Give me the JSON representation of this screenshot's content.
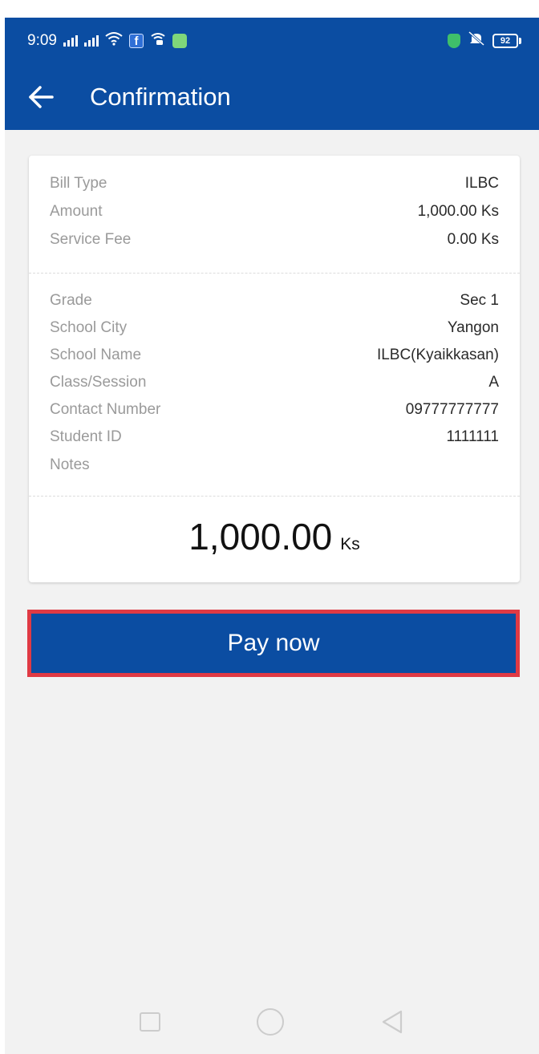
{
  "status_bar": {
    "time": "9:09",
    "battery": "92",
    "icons": [
      "signal-icon",
      "signal-icon",
      "wifi-icon",
      "facebook-icon",
      "wifi-calling-icon",
      "message-icon",
      "shield-icon",
      "mute-icon",
      "battery-icon"
    ]
  },
  "header": {
    "back_icon": "arrow-left-icon",
    "title": "Confirmation"
  },
  "summary": [
    {
      "label": "Bill Type",
      "value": "ILBC"
    },
    {
      "label": "Amount",
      "value": "1,000.00 Ks"
    },
    {
      "label": "Service Fee",
      "value": "0.00 Ks"
    }
  ],
  "details": [
    {
      "label": "Grade",
      "value": "Sec 1"
    },
    {
      "label": "School City",
      "value": "Yangon"
    },
    {
      "label": "School Name",
      "value": "ILBC(Kyaikkasan)"
    },
    {
      "label": "Class/Session",
      "value": "A"
    },
    {
      "label": "Contact Number",
      "value": "09777777777"
    },
    {
      "label": "Student ID",
      "value": "1111111"
    },
    {
      "label": "Notes",
      "value": ""
    }
  ],
  "total": {
    "amount": "1,000.00",
    "currency": "Ks"
  },
  "pay_button": {
    "label": "Pay now",
    "highlight_color": "#e03a44"
  },
  "colors": {
    "primary": "#0b4da2",
    "background": "#f2f2f2",
    "label_grey": "#9a9a9a"
  },
  "nav_bar": {
    "icons": [
      "recent-apps-icon",
      "home-icon",
      "back-triangle-icon"
    ]
  }
}
